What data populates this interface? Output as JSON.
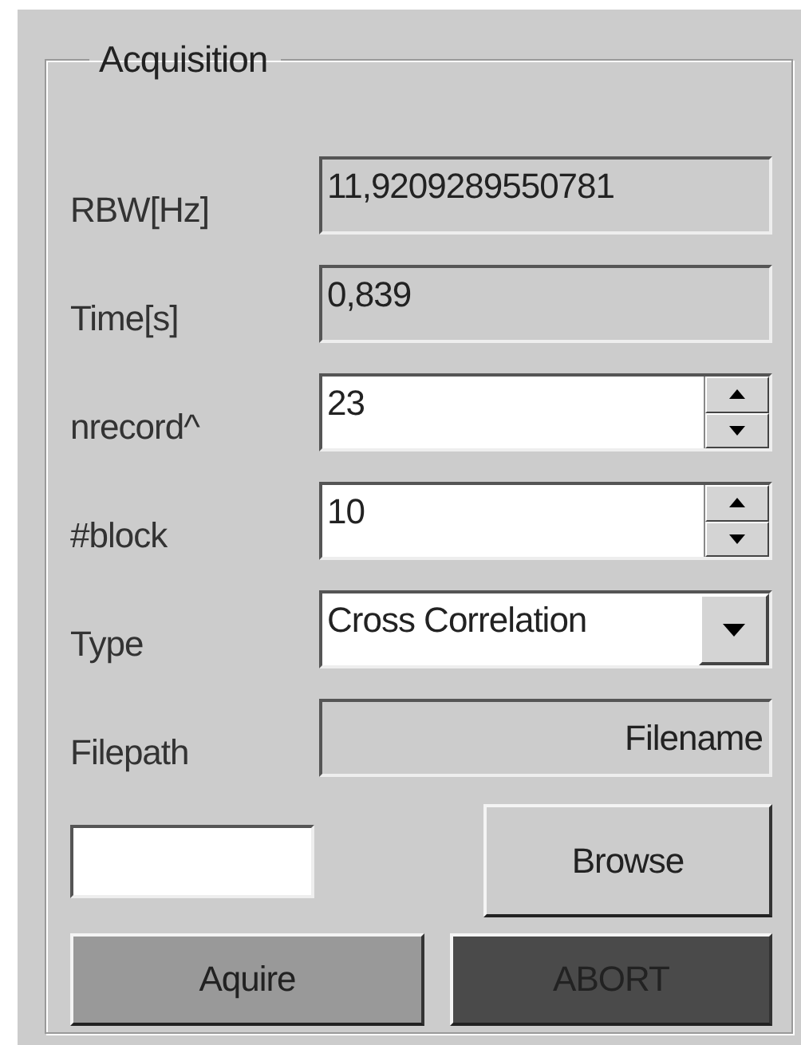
{
  "group": {
    "title": "Acquisition"
  },
  "rows": [
    {
      "label": "RBW[Hz]",
      "kind": "indicator",
      "value": "11,9209289550781"
    },
    {
      "label": "Time[s]",
      "kind": "indicator",
      "value": "0,839"
    },
    {
      "label": "nrecord^",
      "kind": "numeric",
      "value": "23"
    },
    {
      "label": "#block",
      "kind": "numeric",
      "value": "10"
    },
    {
      "label": "Type",
      "kind": "dropdown",
      "value": "Cross Correlation"
    },
    {
      "label": "Filepath",
      "kind": "path",
      "value": "Filename"
    }
  ],
  "browse_button": "Browse",
  "buttons": [
    {
      "label": "Aquire",
      "kind": "normal"
    },
    {
      "label": "ABORT",
      "kind": "dark"
    }
  ]
}
